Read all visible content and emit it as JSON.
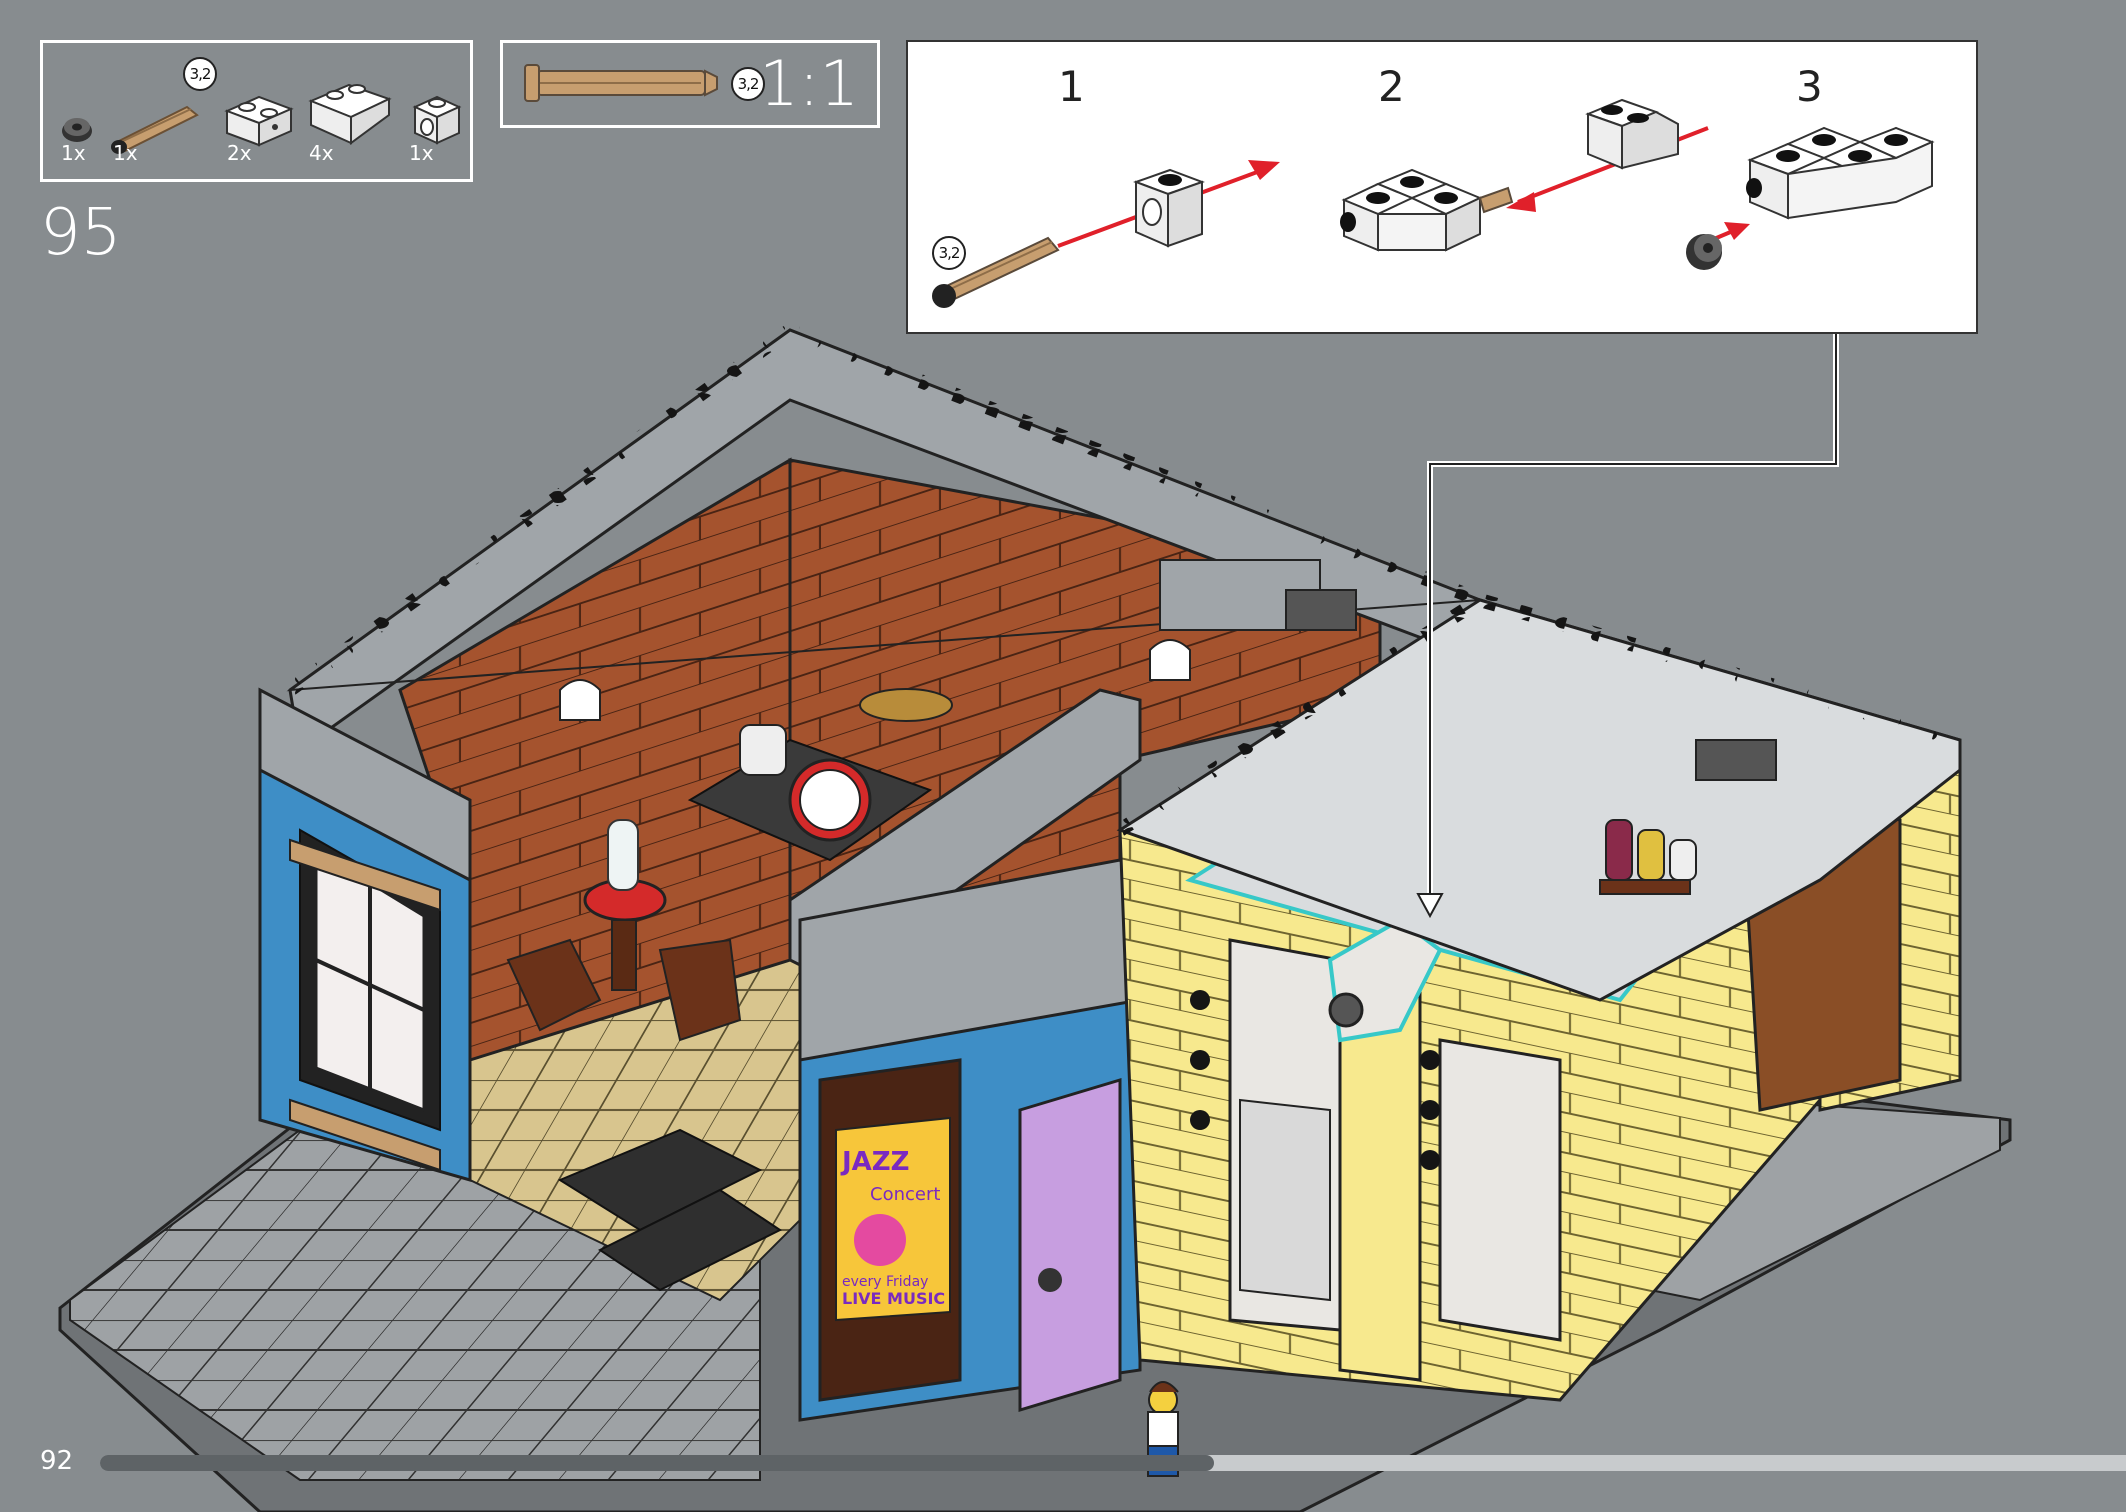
{
  "step": {
    "number": "95"
  },
  "page": {
    "number": "92"
  },
  "progress": {
    "fraction": 0.55
  },
  "parts_list": [
    {
      "qty": "1x",
      "icon": "round-bush-icon"
    },
    {
      "qty": "1x",
      "icon": "axle-pin-icon",
      "badge": "3,2"
    },
    {
      "qty": "2x",
      "icon": "brick-1x2-with-holes-icon"
    },
    {
      "qty": "4x",
      "icon": "slope-brick-icon"
    },
    {
      "qty": "1x",
      "icon": "brick-1x1-with-hole-icon"
    }
  ],
  "scale_callout": {
    "badge": "3,2",
    "label": "1:1"
  },
  "sub_steps": [
    {
      "number": "1",
      "badge": "3,2"
    },
    {
      "number": "2"
    },
    {
      "number": "3"
    }
  ],
  "poster": {
    "title": "JAZZ",
    "subtitle": "Concert",
    "line1": "every Friday",
    "line2": "LIVE MUSIC"
  },
  "colors": {
    "background": "#878c8f",
    "highlight": "#37c8c8",
    "arrow": "#e0202a",
    "brick_brown": "#a5532e",
    "yellow": "#f7e98e",
    "blue": "#3e8ec6",
    "grey": "#a0a5a9",
    "tan": "#d8c58e",
    "pin_tan": "#c79e6f"
  }
}
